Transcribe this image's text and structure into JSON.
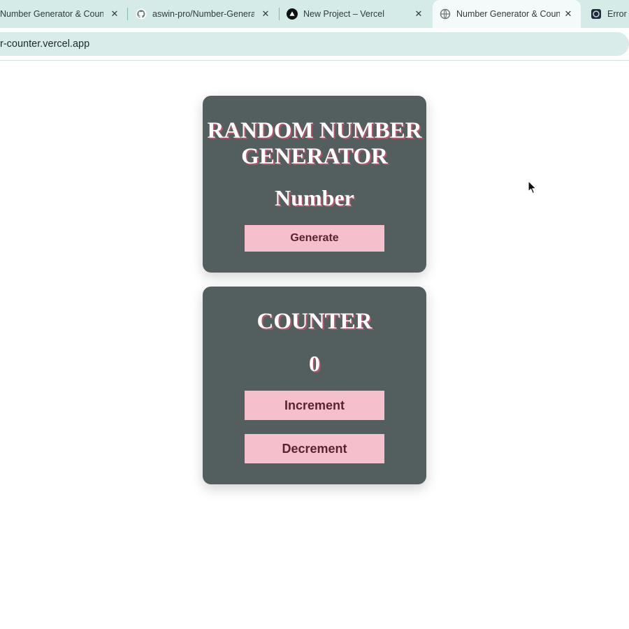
{
  "browser": {
    "tabs": [
      {
        "title": "Number Generator & Counter",
        "icon": "globe-icon",
        "active": false
      },
      {
        "title": "aswin-pro/Number-Generator",
        "icon": "github-icon",
        "active": false
      },
      {
        "title": "New Project – Vercel",
        "icon": "vercel-icon",
        "active": false
      },
      {
        "title": "Number Generator & Counter",
        "icon": "globe-icon",
        "active": true
      },
      {
        "title": "Error",
        "icon": "app-icon",
        "active": false
      }
    ],
    "close_glyph": "✕",
    "url": "r-counter.vercel.app"
  },
  "random_generator": {
    "title": "RANDOM NUMBER GENERATOR",
    "number": "Number",
    "generate_label": "Generate"
  },
  "counter": {
    "title": "COUNTER",
    "value": "0",
    "increment_label": "Increment",
    "decrement_label": "Decrement"
  },
  "colors": {
    "tabstrip": "#d4ebe7",
    "card": "#525f5e",
    "button": "#f5bfcb",
    "button_text": "#5a2330",
    "heading_shadow": "#b3546a"
  }
}
